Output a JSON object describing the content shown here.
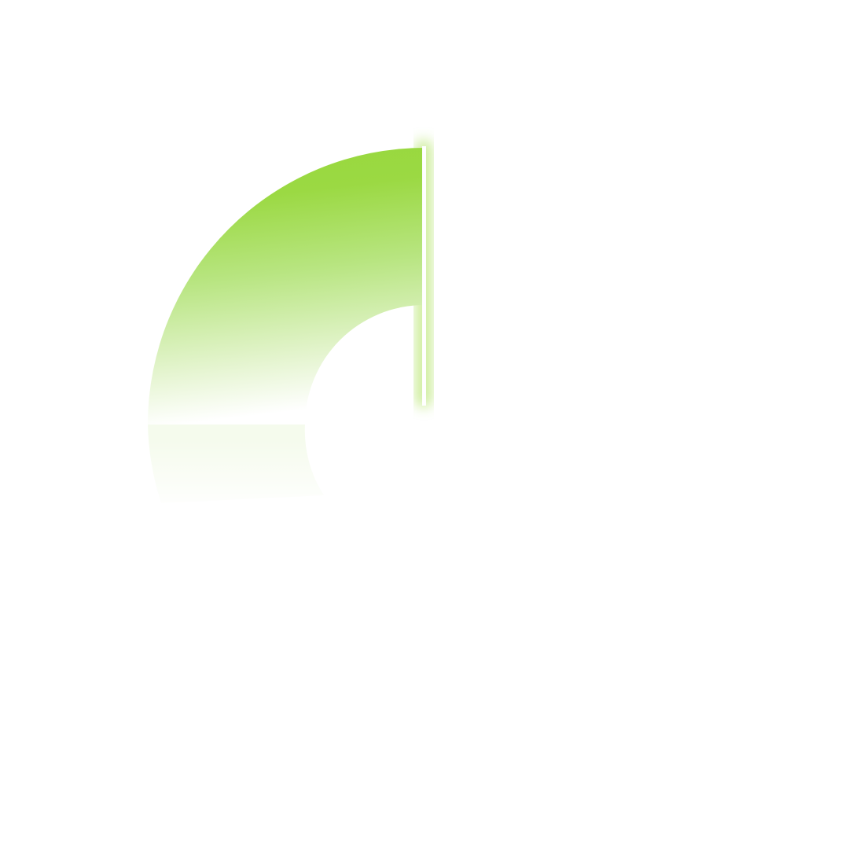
{
  "graphic": {
    "shape": "ring-arc",
    "arc_start_deg": 180,
    "arc_end_deg": 360,
    "colors": {
      "fill_top": "#97d83c",
      "fill_mid": "#b6e57d",
      "fill_fade": "#ffffff",
      "glow": "#c7eb8f",
      "divider": "#ffffff"
    }
  }
}
